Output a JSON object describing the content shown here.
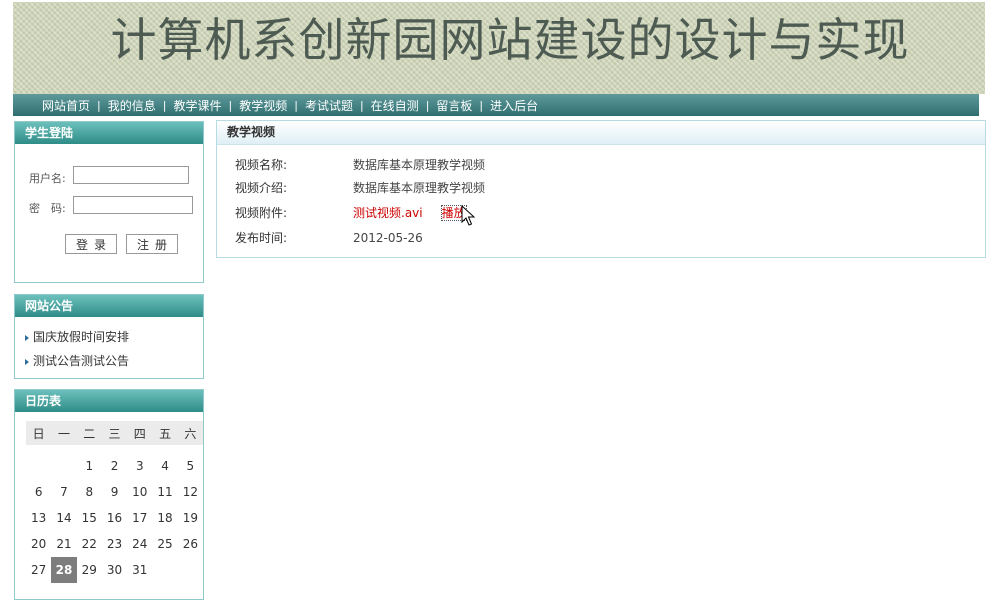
{
  "banner": {
    "title": "计算机系创新园网站建设的设计与实现"
  },
  "nav": [
    {
      "label": "网站首页"
    },
    {
      "label": "我的信息"
    },
    {
      "label": "教学课件"
    },
    {
      "label": "教学视频"
    },
    {
      "label": "考试试题"
    },
    {
      "label": "在线自测"
    },
    {
      "label": "留言板"
    },
    {
      "label": "进入后台"
    }
  ],
  "nav_separator": "|",
  "login": {
    "title": "学生登陆",
    "username_label": "用户名:",
    "password_label": "密　码:",
    "username_value": "",
    "password_value": "",
    "login_button": "登录",
    "register_button": "注册"
  },
  "notices": {
    "title": "网站公告",
    "items": [
      "国庆放假时间安排",
      "测试公告测试公告"
    ]
  },
  "calendar": {
    "title": "日历表",
    "weekdays": [
      "日",
      "一",
      "二",
      "三",
      "四",
      "五",
      "六"
    ],
    "weeks": [
      [
        "",
        "",
        "1",
        "2",
        "3",
        "4",
        "5"
      ],
      [
        "6",
        "7",
        "8",
        "9",
        "10",
        "11",
        "12"
      ],
      [
        "13",
        "14",
        "15",
        "16",
        "17",
        "18",
        "19"
      ],
      [
        "20",
        "21",
        "22",
        "23",
        "24",
        "25",
        "26"
      ],
      [
        "27",
        "28",
        "29",
        "30",
        "31",
        "",
        ""
      ]
    ],
    "today": "28"
  },
  "video": {
    "title": "教学视频",
    "name_label": "视频名称:",
    "name_value": "数据库基本原理教学视频",
    "intro_label": "视频介绍:",
    "intro_value": "数据库基本原理教学视频",
    "attach_label": "视频附件:",
    "attach_file": "测试视频.avi",
    "play_link": "播放",
    "date_label": "发布时间:",
    "date_value": "2012-05-26"
  },
  "colors": {
    "nav": "#2f6e6f",
    "box_head": "#2e8c87",
    "link_red": "#cc0000"
  },
  "icons": {
    "cursor": "mouse-pointer-icon",
    "bullet": "bullet-arrow-icon"
  }
}
